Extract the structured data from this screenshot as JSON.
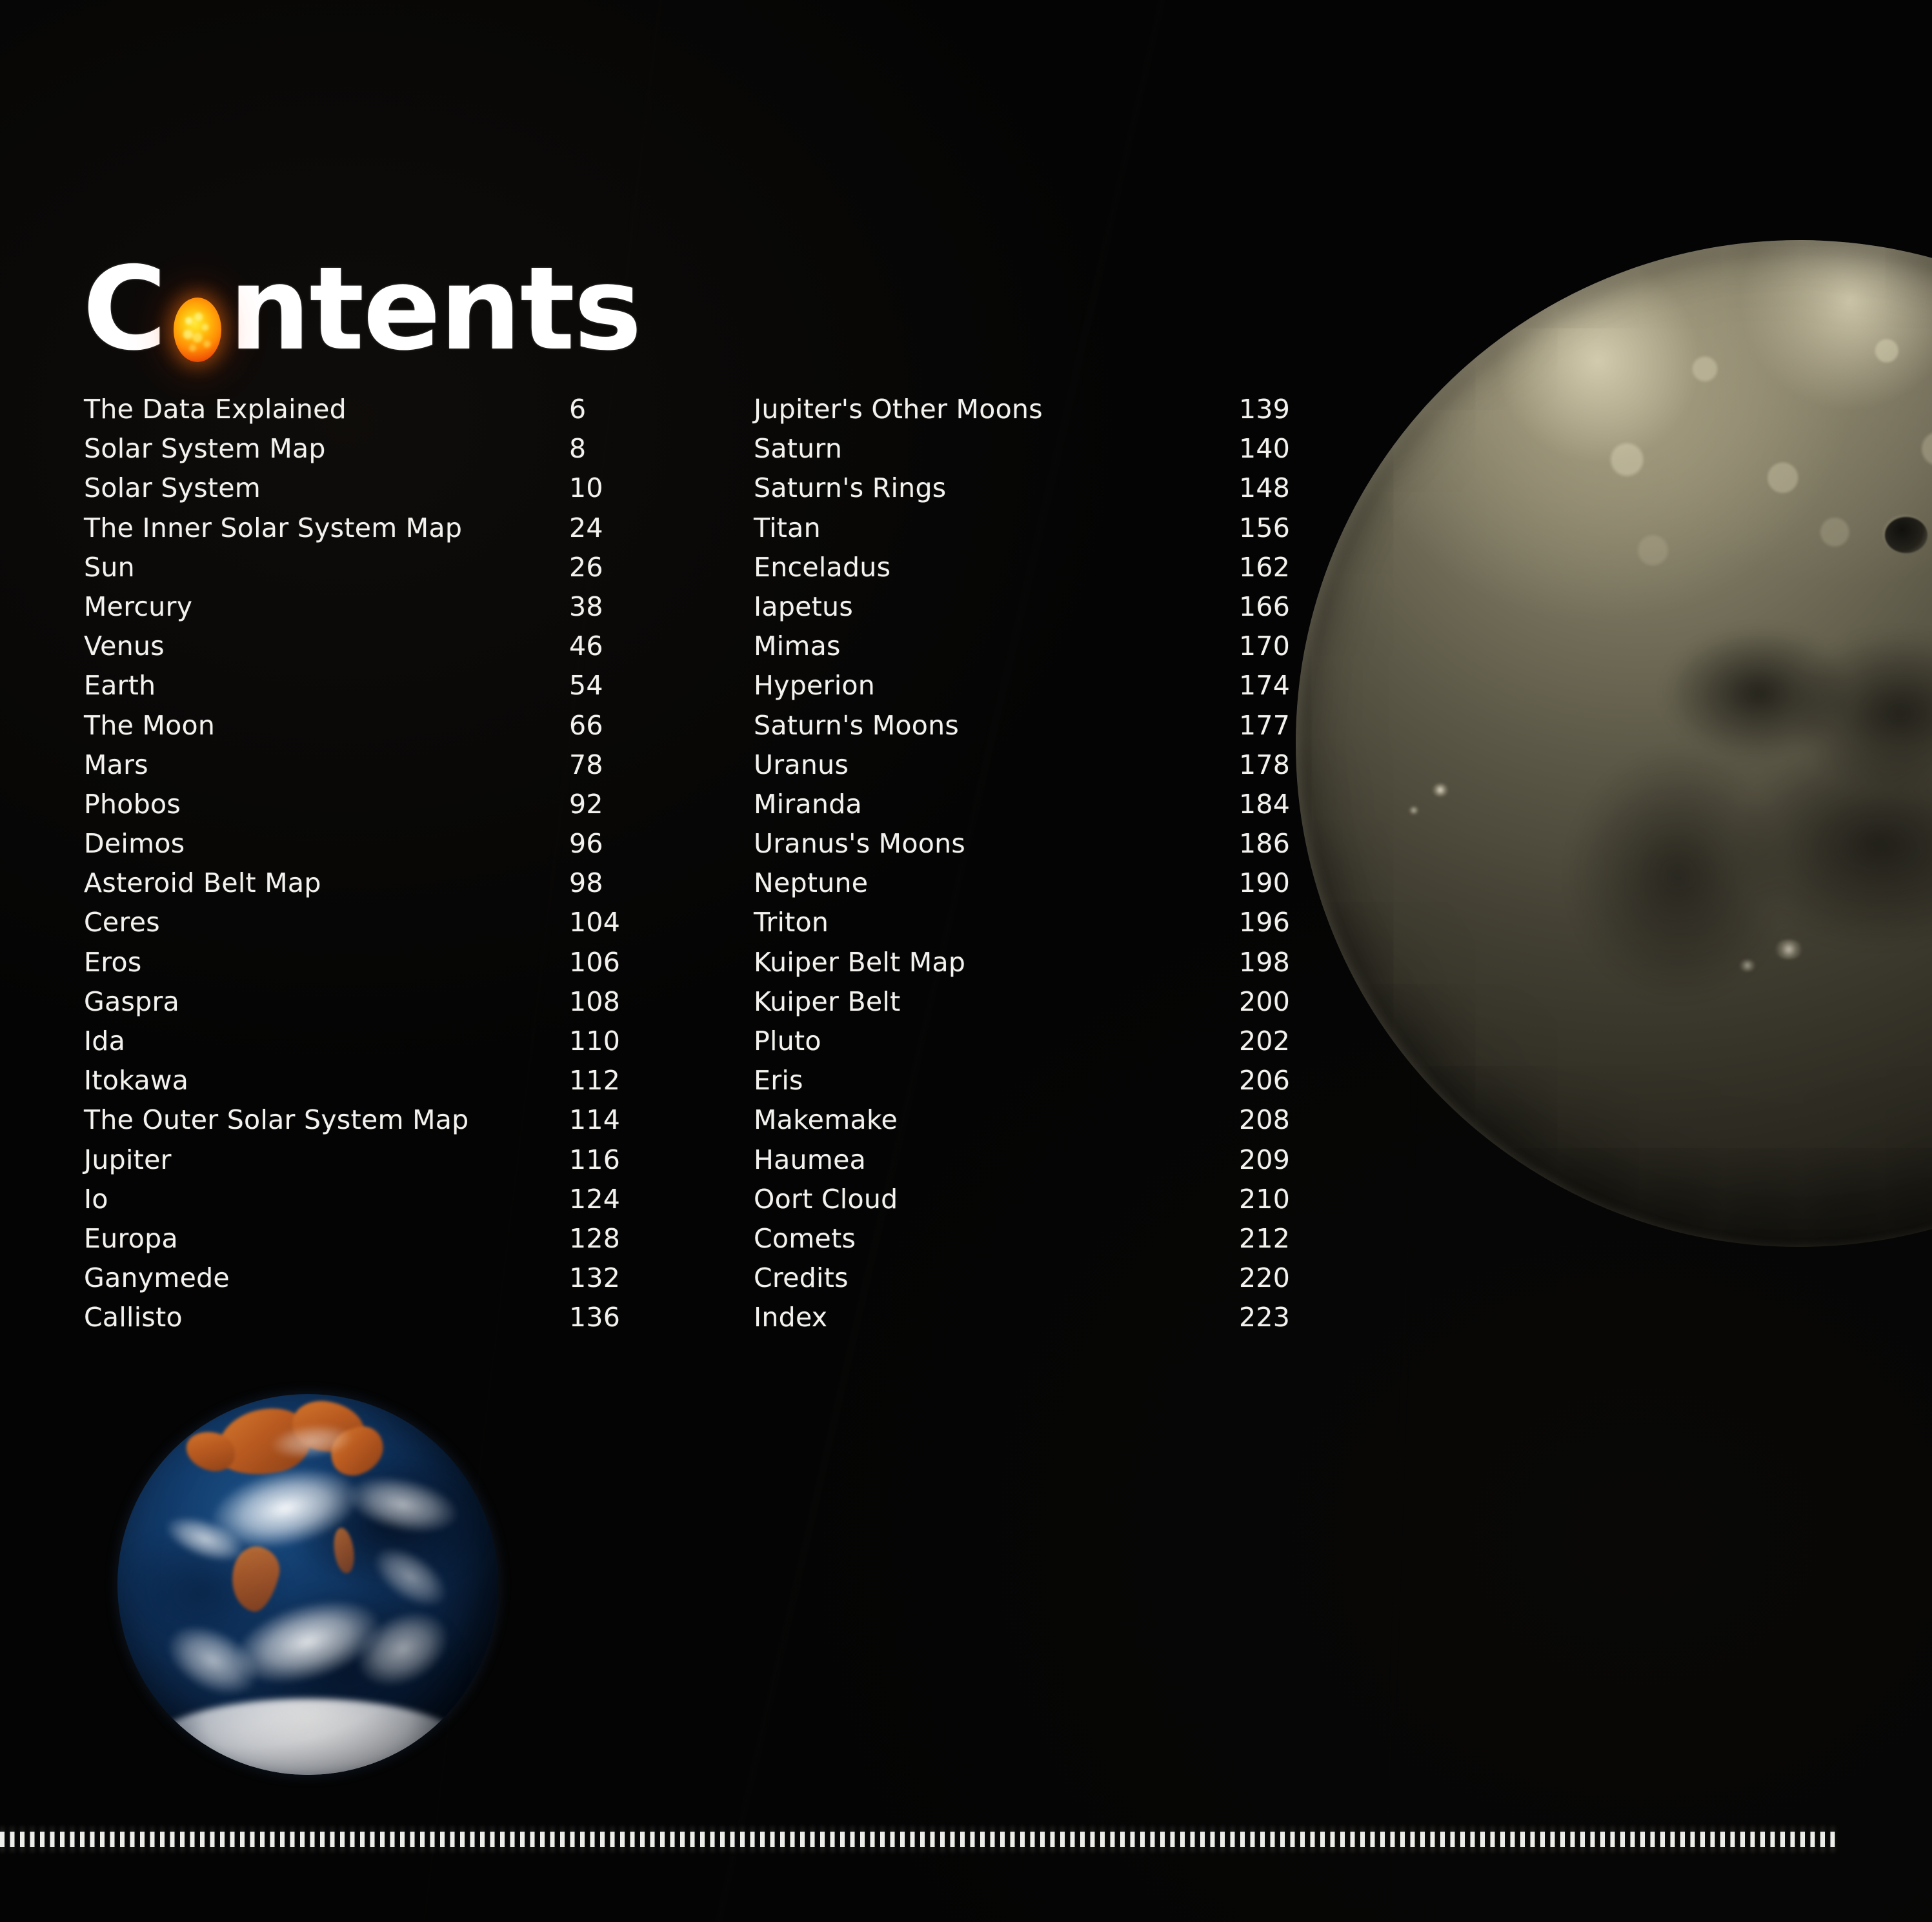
{
  "page": {
    "title": "Contents",
    "background_color": "#040404",
    "text_color": "#f4f2ee"
  },
  "heading": {
    "prefix": "C",
    "sun_glyph": "o",
    "suffix": "ntents",
    "full_text": "Contents",
    "sun_icon_name": "sun-sphere-icon",
    "sun_colors": {
      "core": "#ffe93a",
      "mid": "#ff8a06",
      "edge": "#a81c01"
    }
  },
  "toc": {
    "left_column": [
      {
        "title": "The Data Explained",
        "page": "6"
      },
      {
        "title": "Solar System Map",
        "page": "8"
      },
      {
        "title": "Solar System",
        "page": "10"
      },
      {
        "title": "The Inner Solar System Map",
        "page": "24"
      },
      {
        "title": "Sun",
        "page": "26"
      },
      {
        "title": "Mercury",
        "page": "38"
      },
      {
        "title": "Venus",
        "page": "46"
      },
      {
        "title": "Earth",
        "page": "54"
      },
      {
        "title": "The Moon",
        "page": "66"
      },
      {
        "title": "Mars",
        "page": "78"
      },
      {
        "title": "Phobos",
        "page": "92"
      },
      {
        "title": "Deimos",
        "page": "96"
      },
      {
        "title": "Asteroid Belt Map",
        "page": "98"
      },
      {
        "title": "Ceres",
        "page": "104"
      },
      {
        "title": "Eros",
        "page": "106"
      },
      {
        "title": "Gaspra",
        "page": "108"
      },
      {
        "title": "Ida",
        "page": "110"
      },
      {
        "title": "Itokawa",
        "page": "112"
      },
      {
        "title": "The Outer Solar System Map",
        "page": "114"
      },
      {
        "title": "Jupiter",
        "page": "116"
      },
      {
        "title": "Io",
        "page": "124"
      },
      {
        "title": "Europa",
        "page": "128"
      },
      {
        "title": "Ganymede",
        "page": "132"
      },
      {
        "title": "Callisto",
        "page": "136"
      }
    ],
    "right_column": [
      {
        "title": "Jupiter's Other Moons",
        "page": "139"
      },
      {
        "title": "Saturn",
        "page": "140"
      },
      {
        "title": "Saturn's Rings",
        "page": "148"
      },
      {
        "title": "Titan",
        "page": "156"
      },
      {
        "title": "Enceladus",
        "page": "162"
      },
      {
        "title": "Iapetus",
        "page": "166"
      },
      {
        "title": "Mimas",
        "page": "170"
      },
      {
        "title": "Hyperion",
        "page": "174"
      },
      {
        "title": "Saturn's Moons",
        "page": "177"
      },
      {
        "title": "Uranus",
        "page": "178"
      },
      {
        "title": "Miranda",
        "page": "184"
      },
      {
        "title": "Uranus's Moons",
        "page": "186"
      },
      {
        "title": "Neptune",
        "page": "190"
      },
      {
        "title": "Triton",
        "page": "196"
      },
      {
        "title": "Kuiper Belt Map",
        "page": "198"
      },
      {
        "title": "Kuiper Belt",
        "page": "200"
      },
      {
        "title": "Pluto",
        "page": "202"
      },
      {
        "title": "Eris",
        "page": "206"
      },
      {
        "title": "Makemake",
        "page": "208"
      },
      {
        "title": "Haumea",
        "page": "209"
      },
      {
        "title": "Oort Cloud",
        "page": "210"
      },
      {
        "title": "Comets",
        "page": "212"
      },
      {
        "title": "Credits",
        "page": "220"
      },
      {
        "title": "Index",
        "page": "223"
      }
    ]
  },
  "imagery": {
    "moon": {
      "name": "moon-photo",
      "description": "Moon partially visible at upper right, lit from upper left",
      "tint": "#7c7760"
    },
    "earth": {
      "name": "earth-photo",
      "description": "Blue Marble Earth at lower left",
      "ocean_color": "#123c6c",
      "land_color": "#b85a20",
      "cloud_color": "#ffffff"
    }
  },
  "ruler": {
    "name": "ruler-tick-strip",
    "tick_color": "#f4f4f0"
  }
}
